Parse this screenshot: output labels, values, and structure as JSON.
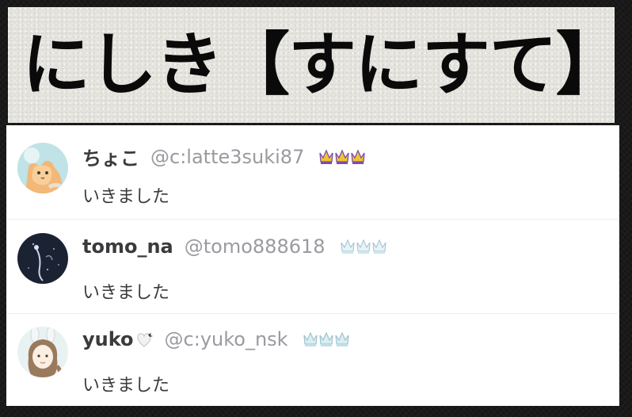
{
  "title": "にしき【すにすて】",
  "comments": [
    {
      "username": "ちょこ",
      "handle": "@c:latte3suki87",
      "badge": "crown-icon",
      "badge_color": "#f2c230",
      "message": "いきました"
    },
    {
      "username": "tomo_na",
      "handle": "@tomo888618",
      "badge": "crown-icon",
      "badge_color": "#cfe6ef",
      "message": "いきました"
    },
    {
      "username": "yuko",
      "handle": "@c:yuko_nsk",
      "badge": "crown-icon",
      "badge_color": "#bfe0e8",
      "message": "いきました"
    }
  ]
}
